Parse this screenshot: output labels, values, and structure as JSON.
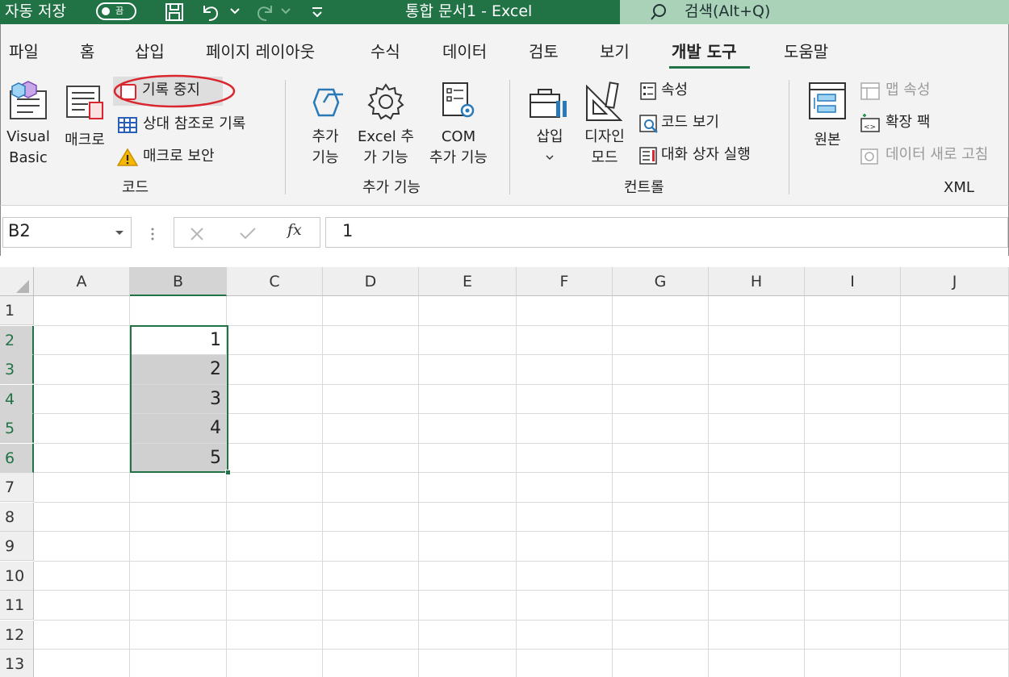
{
  "titlebar": {
    "autosave_label": "자동 저장",
    "autosave_state": "끔",
    "doc_title": "통합 문서1  -  Excel",
    "search_placeholder": "검색(Alt+Q)"
  },
  "menu": {
    "tabs": [
      "파일",
      "홈",
      "삽입",
      "페이지 레이아웃",
      "수식",
      "데이터",
      "검토",
      "보기",
      "개발 도구",
      "도움말"
    ],
    "active_tab": "개발 도구"
  },
  "ribbon": {
    "code": {
      "group_label": "코드",
      "visual_basic": [
        "Visual",
        "Basic"
      ],
      "macro": "매크로",
      "stop_recording": "기록 중지",
      "relative_ref": "상대 참조로 기록",
      "macro_security": "매크로 보안"
    },
    "addins": {
      "group_label": "추가 기능",
      "addins": [
        "추가",
        "기능"
      ],
      "excel_addins": [
        "Excel 추",
        "가 기능"
      ],
      "com_addins": [
        "COM",
        "추가 기능"
      ]
    },
    "controls": {
      "group_label": "컨트롤",
      "insert": "삽입",
      "design_mode": [
        "디자인",
        "모드"
      ],
      "properties": "속성",
      "view_code": "코드 보기",
      "run_dialog": "대화 상자 실행"
    },
    "xml": {
      "group_label": "XML",
      "source": "원본",
      "map_properties": "맵 속성",
      "expansion_packs": "확장 팩",
      "refresh_data": "데이터 새로 고침"
    }
  },
  "formula_bar": {
    "name_box": "B2",
    "fx_label": "fx",
    "value": "1"
  },
  "sheet": {
    "columns": [
      "A",
      "B",
      "C",
      "D",
      "E",
      "F",
      "G",
      "H",
      "I",
      "J"
    ],
    "rows": [
      "1",
      "2",
      "3",
      "4",
      "5",
      "6",
      "7",
      "8",
      "9",
      "10",
      "11",
      "12",
      "13"
    ],
    "cells": {
      "B2": "1",
      "B3": "2",
      "B4": "3",
      "B5": "4",
      "B6": "5"
    },
    "selection": "B2:B6",
    "active_cell": "B2"
  },
  "colors": {
    "excel_green": "#217346",
    "search_bg": "#a9d2b9",
    "highlight_red": "#d9262f",
    "selection_fill": "#d0d0d0"
  }
}
